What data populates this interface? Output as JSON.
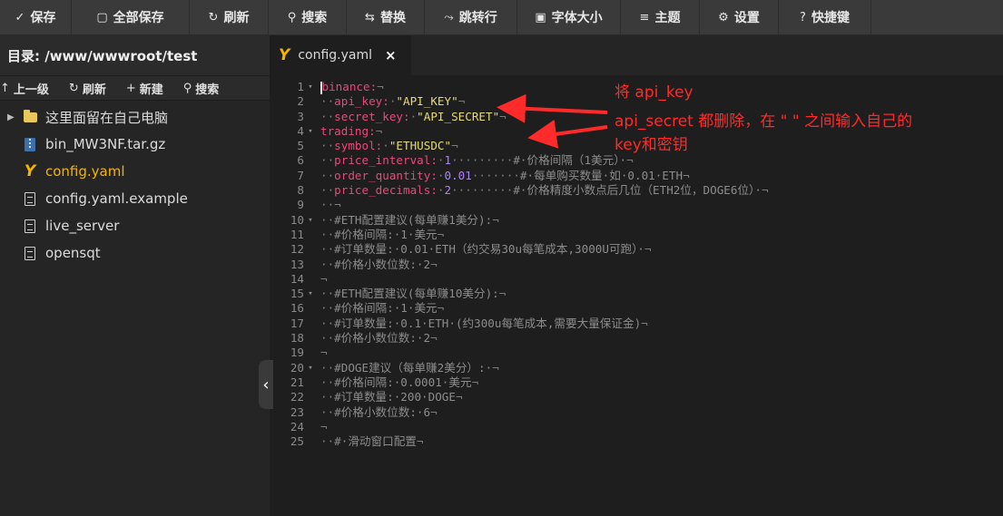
{
  "toolbar": {
    "buttons": [
      {
        "icon": "✓",
        "label": "保存"
      },
      {
        "icon": "▢",
        "label": "全部保存"
      },
      {
        "icon": "↻",
        "label": "刷新"
      },
      {
        "icon": "⚲",
        "label": "搜索"
      },
      {
        "icon": "⇆",
        "label": "替换"
      },
      {
        "icon": "⤳",
        "label": "跳转行"
      },
      {
        "icon": "▣",
        "label": "字体大小"
      },
      {
        "icon": "≡",
        "label": "主题"
      },
      {
        "icon": "⚙",
        "label": "设置"
      },
      {
        "icon": "?",
        "label": "快捷键"
      }
    ]
  },
  "sidebar": {
    "directory_label": "目录: /www/wwwroot/test",
    "actions": [
      {
        "icon": "↑",
        "label": "上一级"
      },
      {
        "icon": "↻",
        "label": "刷新"
      },
      {
        "icon": "+",
        "label": "新建"
      },
      {
        "icon": "⚲",
        "label": "搜索"
      }
    ],
    "files": [
      {
        "name": "这里面留在自己电脑",
        "type": "folder",
        "active": false
      },
      {
        "name": "bin_MW3NF.tar.gz",
        "type": "archive",
        "active": false
      },
      {
        "name": "config.yaml",
        "type": "yaml",
        "active": true
      },
      {
        "name": "config.yaml.example",
        "type": "file",
        "active": false
      },
      {
        "name": "live_server",
        "type": "file",
        "active": false
      },
      {
        "name": "opensqt",
        "type": "file",
        "active": false
      }
    ]
  },
  "editor": {
    "tab_label": "config.yaml",
    "tab_close": "×",
    "lines": [
      {
        "n": "1",
        "fold": true,
        "segs": [
          [
            "k",
            "binance:"
          ],
          [
            "t",
            "¬"
          ]
        ]
      },
      {
        "n": "2",
        "segs": [
          [
            "t",
            "··"
          ],
          [
            "k",
            "api_key:"
          ],
          [
            "t",
            "·"
          ],
          [
            "s",
            "\"API_KEY\""
          ],
          [
            "t",
            "¬"
          ]
        ]
      },
      {
        "n": "3",
        "segs": [
          [
            "t",
            "··"
          ],
          [
            "k",
            "secret_key:"
          ],
          [
            "t",
            "·"
          ],
          [
            "s",
            "\"API_SECRET\""
          ],
          [
            "t",
            "¬"
          ]
        ]
      },
      {
        "n": "4",
        "fold": true,
        "segs": [
          [
            "k",
            "trading:"
          ],
          [
            "t",
            "¬"
          ]
        ]
      },
      {
        "n": "5",
        "segs": [
          [
            "t",
            "··"
          ],
          [
            "k",
            "symbol:"
          ],
          [
            "t",
            "·"
          ],
          [
            "s",
            "\"ETHUSDC\""
          ],
          [
            "t",
            "¬"
          ]
        ]
      },
      {
        "n": "6",
        "segs": [
          [
            "t",
            "··"
          ],
          [
            "k",
            "price_interval:"
          ],
          [
            "t",
            "·"
          ],
          [
            "n",
            "1"
          ],
          [
            "t",
            "·········"
          ],
          [
            "c",
            "#·价格间隔（1美元）·"
          ],
          [
            "t",
            "¬"
          ]
        ]
      },
      {
        "n": "7",
        "segs": [
          [
            "t",
            "··"
          ],
          [
            "k",
            "order_quantity:"
          ],
          [
            "t",
            "·"
          ],
          [
            "n",
            "0.01"
          ],
          [
            "t",
            "·······"
          ],
          [
            "c",
            "#·每单购买数量·如·0.01·ETH"
          ],
          [
            "t",
            "¬"
          ]
        ]
      },
      {
        "n": "8",
        "segs": [
          [
            "t",
            "··"
          ],
          [
            "k",
            "price_decimals:"
          ],
          [
            "t",
            "·"
          ],
          [
            "n",
            "2"
          ],
          [
            "t",
            "·········"
          ],
          [
            "c",
            "#·价格精度小数点后几位（ETH2位，DOGE6位）·"
          ],
          [
            "t",
            "¬"
          ]
        ]
      },
      {
        "n": "9",
        "segs": [
          [
            "t",
            "··¬"
          ]
        ]
      },
      {
        "n": "10",
        "fold": true,
        "segs": [
          [
            "t",
            "··"
          ],
          [
            "c",
            "#ETH配置建议(每单赚1美分):"
          ],
          [
            "t",
            "¬"
          ]
        ]
      },
      {
        "n": "11",
        "segs": [
          [
            "t",
            "··"
          ],
          [
            "c",
            "#价格间隔:·1·美元"
          ],
          [
            "t",
            "¬"
          ]
        ]
      },
      {
        "n": "12",
        "segs": [
          [
            "t",
            "··"
          ],
          [
            "c",
            "#订单数量:·0.01·ETH（约交易30u每笔成本,3000U可跑）·"
          ],
          [
            "t",
            "¬"
          ]
        ]
      },
      {
        "n": "13",
        "segs": [
          [
            "t",
            "··"
          ],
          [
            "c",
            "#价格小数位数:·2"
          ],
          [
            "t",
            "¬"
          ]
        ]
      },
      {
        "n": "14",
        "segs": [
          [
            "t",
            "¬"
          ]
        ]
      },
      {
        "n": "15",
        "fold": true,
        "segs": [
          [
            "t",
            "··"
          ],
          [
            "c",
            "#ETH配置建议(每单赚10美分):"
          ],
          [
            "t",
            "¬"
          ]
        ]
      },
      {
        "n": "16",
        "segs": [
          [
            "t",
            "··"
          ],
          [
            "c",
            "#价格间隔:·1·美元"
          ],
          [
            "t",
            "¬"
          ]
        ]
      },
      {
        "n": "17",
        "segs": [
          [
            "t",
            "··"
          ],
          [
            "c",
            "#订单数量:·0.1·ETH·(约300u每笔成本,需要大量保证金)"
          ],
          [
            "t",
            "¬"
          ]
        ]
      },
      {
        "n": "18",
        "segs": [
          [
            "t",
            "··"
          ],
          [
            "c",
            "#价格小数位数:·2"
          ],
          [
            "t",
            "¬"
          ]
        ]
      },
      {
        "n": "19",
        "segs": [
          [
            "t",
            "¬"
          ]
        ]
      },
      {
        "n": "20",
        "fold": true,
        "segs": [
          [
            "t",
            "··"
          ],
          [
            "c",
            "#DOGE建议（每单赚2美分）:·"
          ],
          [
            "t",
            "¬"
          ]
        ]
      },
      {
        "n": "21",
        "segs": [
          [
            "t",
            "··"
          ],
          [
            "c",
            "#价格间隔:·0.0001·美元"
          ],
          [
            "t",
            "¬"
          ]
        ]
      },
      {
        "n": "22",
        "segs": [
          [
            "t",
            "··"
          ],
          [
            "c",
            "#订单数量:·200·DOGE"
          ],
          [
            "t",
            "¬"
          ]
        ]
      },
      {
        "n": "23",
        "segs": [
          [
            "t",
            "··"
          ],
          [
            "c",
            "#价格小数位数:·6"
          ],
          [
            "t",
            "¬"
          ]
        ]
      },
      {
        "n": "24",
        "segs": [
          [
            "t",
            "¬"
          ]
        ]
      },
      {
        "n": "25",
        "segs": [
          [
            "t",
            "··"
          ],
          [
            "c",
            "#·滑动窗口配置"
          ],
          [
            "t",
            "¬"
          ]
        ]
      }
    ]
  },
  "annotation": {
    "line1": "将 api_key",
    "line2": "api_secret 都删除，在 \" \" 之间输入自己的",
    "line3": "key和密钥",
    "color": "#ff2a2a"
  },
  "colors": {
    "key": "#e64a7a",
    "string": "#e6db74",
    "number": "#ae81ff",
    "comment": "#8c8c8c",
    "active_file": "#f5b400"
  }
}
